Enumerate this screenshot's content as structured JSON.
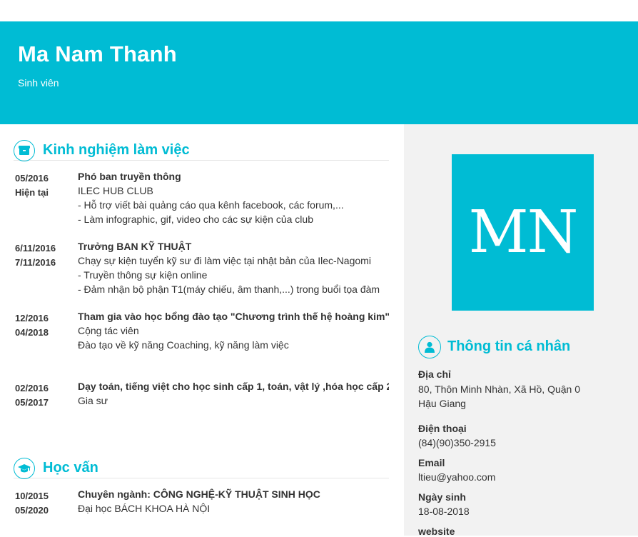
{
  "header": {
    "name": "Ma Nam Thanh",
    "role": "Sinh viên"
  },
  "experience": {
    "title": "Kinh nghiệm làm việc",
    "icon": "briefcase-icon",
    "entries": [
      {
        "date_from": "05/2016",
        "date_to": "Hiện tại",
        "position": "Phó ban truyền thông",
        "lines": [
          "ILEC HUB CLUB",
          "- Hỗ trợ viết bài quảng cáo qua kênh facebook, các forum,...",
          "- Làm infographic, gif, video cho các sự kiện của club"
        ]
      },
      {
        "date_from": "6/11/2016",
        "date_to": "7/11/2016",
        "position": "Trưởng BAN KỸ THUẬT",
        "lines": [
          "Chạy sự kiện tuyển kỹ sư đi làm việc tại nhật bản của Ilec-Nagomi",
          "- Truyền thông sự kiện online",
          "- Đảm nhận bộ phận T1(máy chiếu, âm thanh,...) trong buổi tọa đàm"
        ]
      },
      {
        "date_from": "12/2016",
        "date_to": "04/2018",
        "position": "Tham gia vào học bổng đào tạo \"Chương trình thế hệ hoàng kim\"",
        "lines": [
          "Cộng tác viên",
          "Đào tạo về kỹ năng Coaching, kỹ năng làm việc"
        ]
      },
      {
        "date_from": "02/2016",
        "date_to": "05/2017",
        "position": "Dạy toán, tiếng việt cho học sinh cấp 1, toán, vật lý ,hóa học cấp 2",
        "lines": [
          "Gia sư"
        ]
      }
    ]
  },
  "education": {
    "title": "Học vấn",
    "icon": "graduation-cap-icon",
    "entries": [
      {
        "date_from": "10/2015",
        "date_to": "05/2020",
        "position": "Chuyên ngành: CÔNG NGHỆ-KỸ THUẬT SINH HỌC",
        "lines": [
          "Đại học BÁCH KHOA HÀ NỘI"
        ]
      }
    ]
  },
  "sidebar": {
    "avatar_initials": "MN",
    "info_title": "Thông tin cá nhân",
    "info_icon": "user-icon",
    "address_label": "Địa chỉ",
    "address_line1": "80, Thôn Minh Nhàn, Xã Hồ, Quận 0",
    "address_line2": "Hậu Giang",
    "phone_label": "Điện thoại",
    "phone": "(84)(90)350-2915",
    "email_label": "Email",
    "email": "ltieu@yahoo.com",
    "birthday_label": "Ngày sinh",
    "birthday": "18-08-2018",
    "website_label": "website"
  },
  "colors": {
    "accent": "#00bcd4",
    "sidebar_bg": "#f2f2f2",
    "text": "#333333"
  }
}
